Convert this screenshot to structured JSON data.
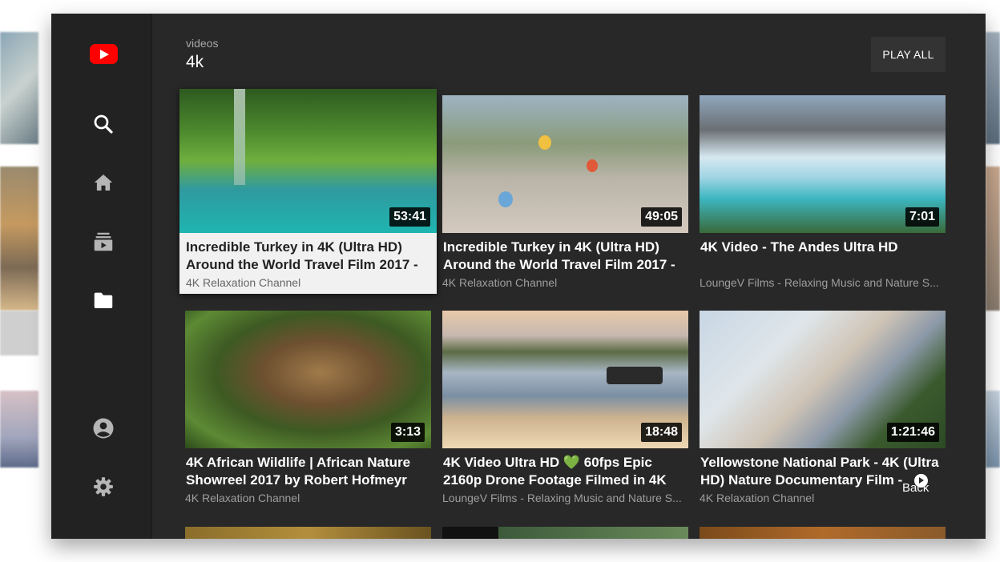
{
  "app": {
    "name": "YouTube TV",
    "brand_color": "#ff0000",
    "panel_color": "#282828",
    "sidebar_color": "#222222"
  },
  "sidebar": {
    "items": [
      {
        "icon": "search-icon"
      },
      {
        "icon": "home-icon"
      },
      {
        "icon": "subscriptions-icon"
      },
      {
        "icon": "library-folder-icon"
      },
      {
        "icon": "account-icon"
      },
      {
        "icon": "settings-icon"
      }
    ]
  },
  "header": {
    "subtitle": "videos",
    "title": "4k",
    "play_all_label": "PLAY ALL"
  },
  "videos": [
    {
      "title": "Incredible Turkey in 4K (Ultra HD) Around the World Travel Film 2017 -",
      "channel": "4K Relaxation Channel",
      "duration": "53:41",
      "focused": true
    },
    {
      "title": "Incredible Turkey in 4K (Ultra HD) Around the World Travel Film 2017 -",
      "channel": "4K Relaxation Channel",
      "duration": "49:05"
    },
    {
      "title": "4K Video - The Andes Ultra HD",
      "channel": "LoungeV Films - Relaxing Music and Nature S...",
      "duration": "7:01"
    },
    {
      "title": "4K African Wildlife | African Nature Showreel 2017 by Robert Hofmeyr",
      "channel": "4K Relaxation Channel",
      "duration": "3:13"
    },
    {
      "title": "4K Video Ultra HD 💚 60fps Epic 2160p Drone Footage Filmed in 4K",
      "channel": "LoungeV Films - Relaxing Music and Nature S...",
      "duration": "18:48"
    },
    {
      "title": "Yellowstone National Park - 4K (Ultra HD) Nature Documentary Film -",
      "channel": "4K Relaxation Channel",
      "duration": "1:21:46"
    }
  ],
  "hints": {
    "back_label": "Back"
  }
}
